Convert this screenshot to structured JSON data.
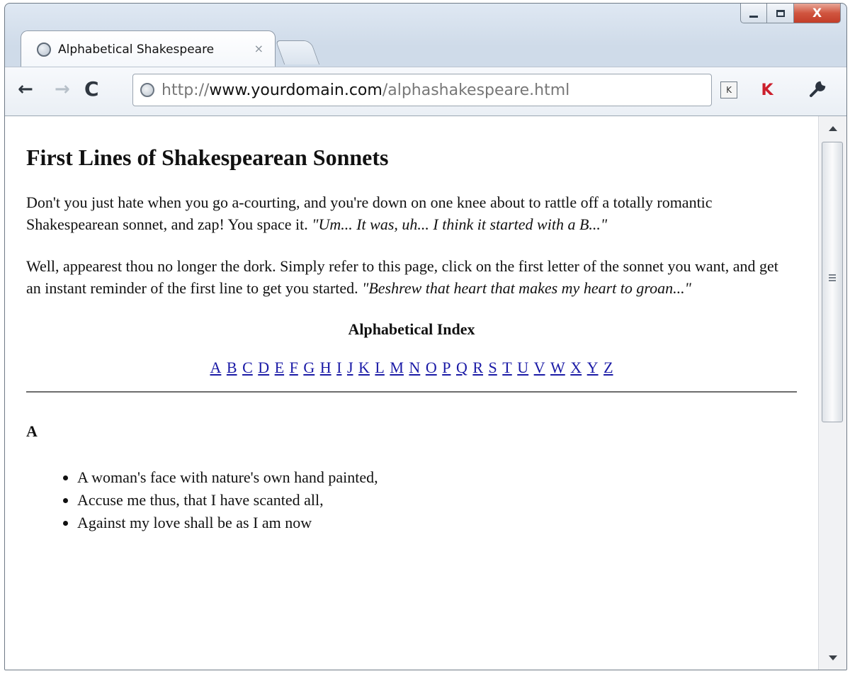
{
  "window": {
    "minimize_icon": "minimize-icon",
    "maximize_icon": "maximize-icon",
    "close_label": "X"
  },
  "tab": {
    "title": "Alphabetical Shakespeare",
    "close_label": "×"
  },
  "toolbar": {
    "back_label": "←",
    "forward_label": "→",
    "reload_label": "C",
    "url_prefix": "http://",
    "url_domain": "www.yourdomain.com",
    "url_path": "/alphashakespeare.html",
    "ext_k_label": "K",
    "ext_kas_label": "K",
    "wrench_label": "🔧"
  },
  "page": {
    "heading": "First Lines of Shakespearean Sonnets",
    "intro_text": "Don't you just hate when you go a-courting, and you're down on one knee about to rattle off a totally romantic Shakespearean sonnet, and zap! You space it. ",
    "intro_italic": "\"Um... It was, uh... I think it started with a B...\"",
    "second_text": "Well, appearest thou no longer the dork. Simply refer to this page, click on the first letter of the sonnet you want, and get an instant reminder of the first line to get you started. ",
    "second_italic": "\"Beshrew that heart that makes my heart to groan...\"",
    "index_title": "Alphabetical Index",
    "letters": [
      "A",
      "B",
      "C",
      "D",
      "E",
      "F",
      "G",
      "H",
      "I",
      "J",
      "K",
      "L",
      "M",
      "N",
      "O",
      "P",
      "Q",
      "R",
      "S",
      "T",
      "U",
      "V",
      "W",
      "X",
      "Y",
      "Z"
    ],
    "section_a": "A",
    "lines_a": [
      "A woman's face with nature's own hand painted,",
      "Accuse me thus, that I have scanted all,",
      "Against my love shall be as I am now"
    ]
  },
  "colors": {
    "link": "#1a1aa6",
    "close_button": "#c33d29"
  }
}
